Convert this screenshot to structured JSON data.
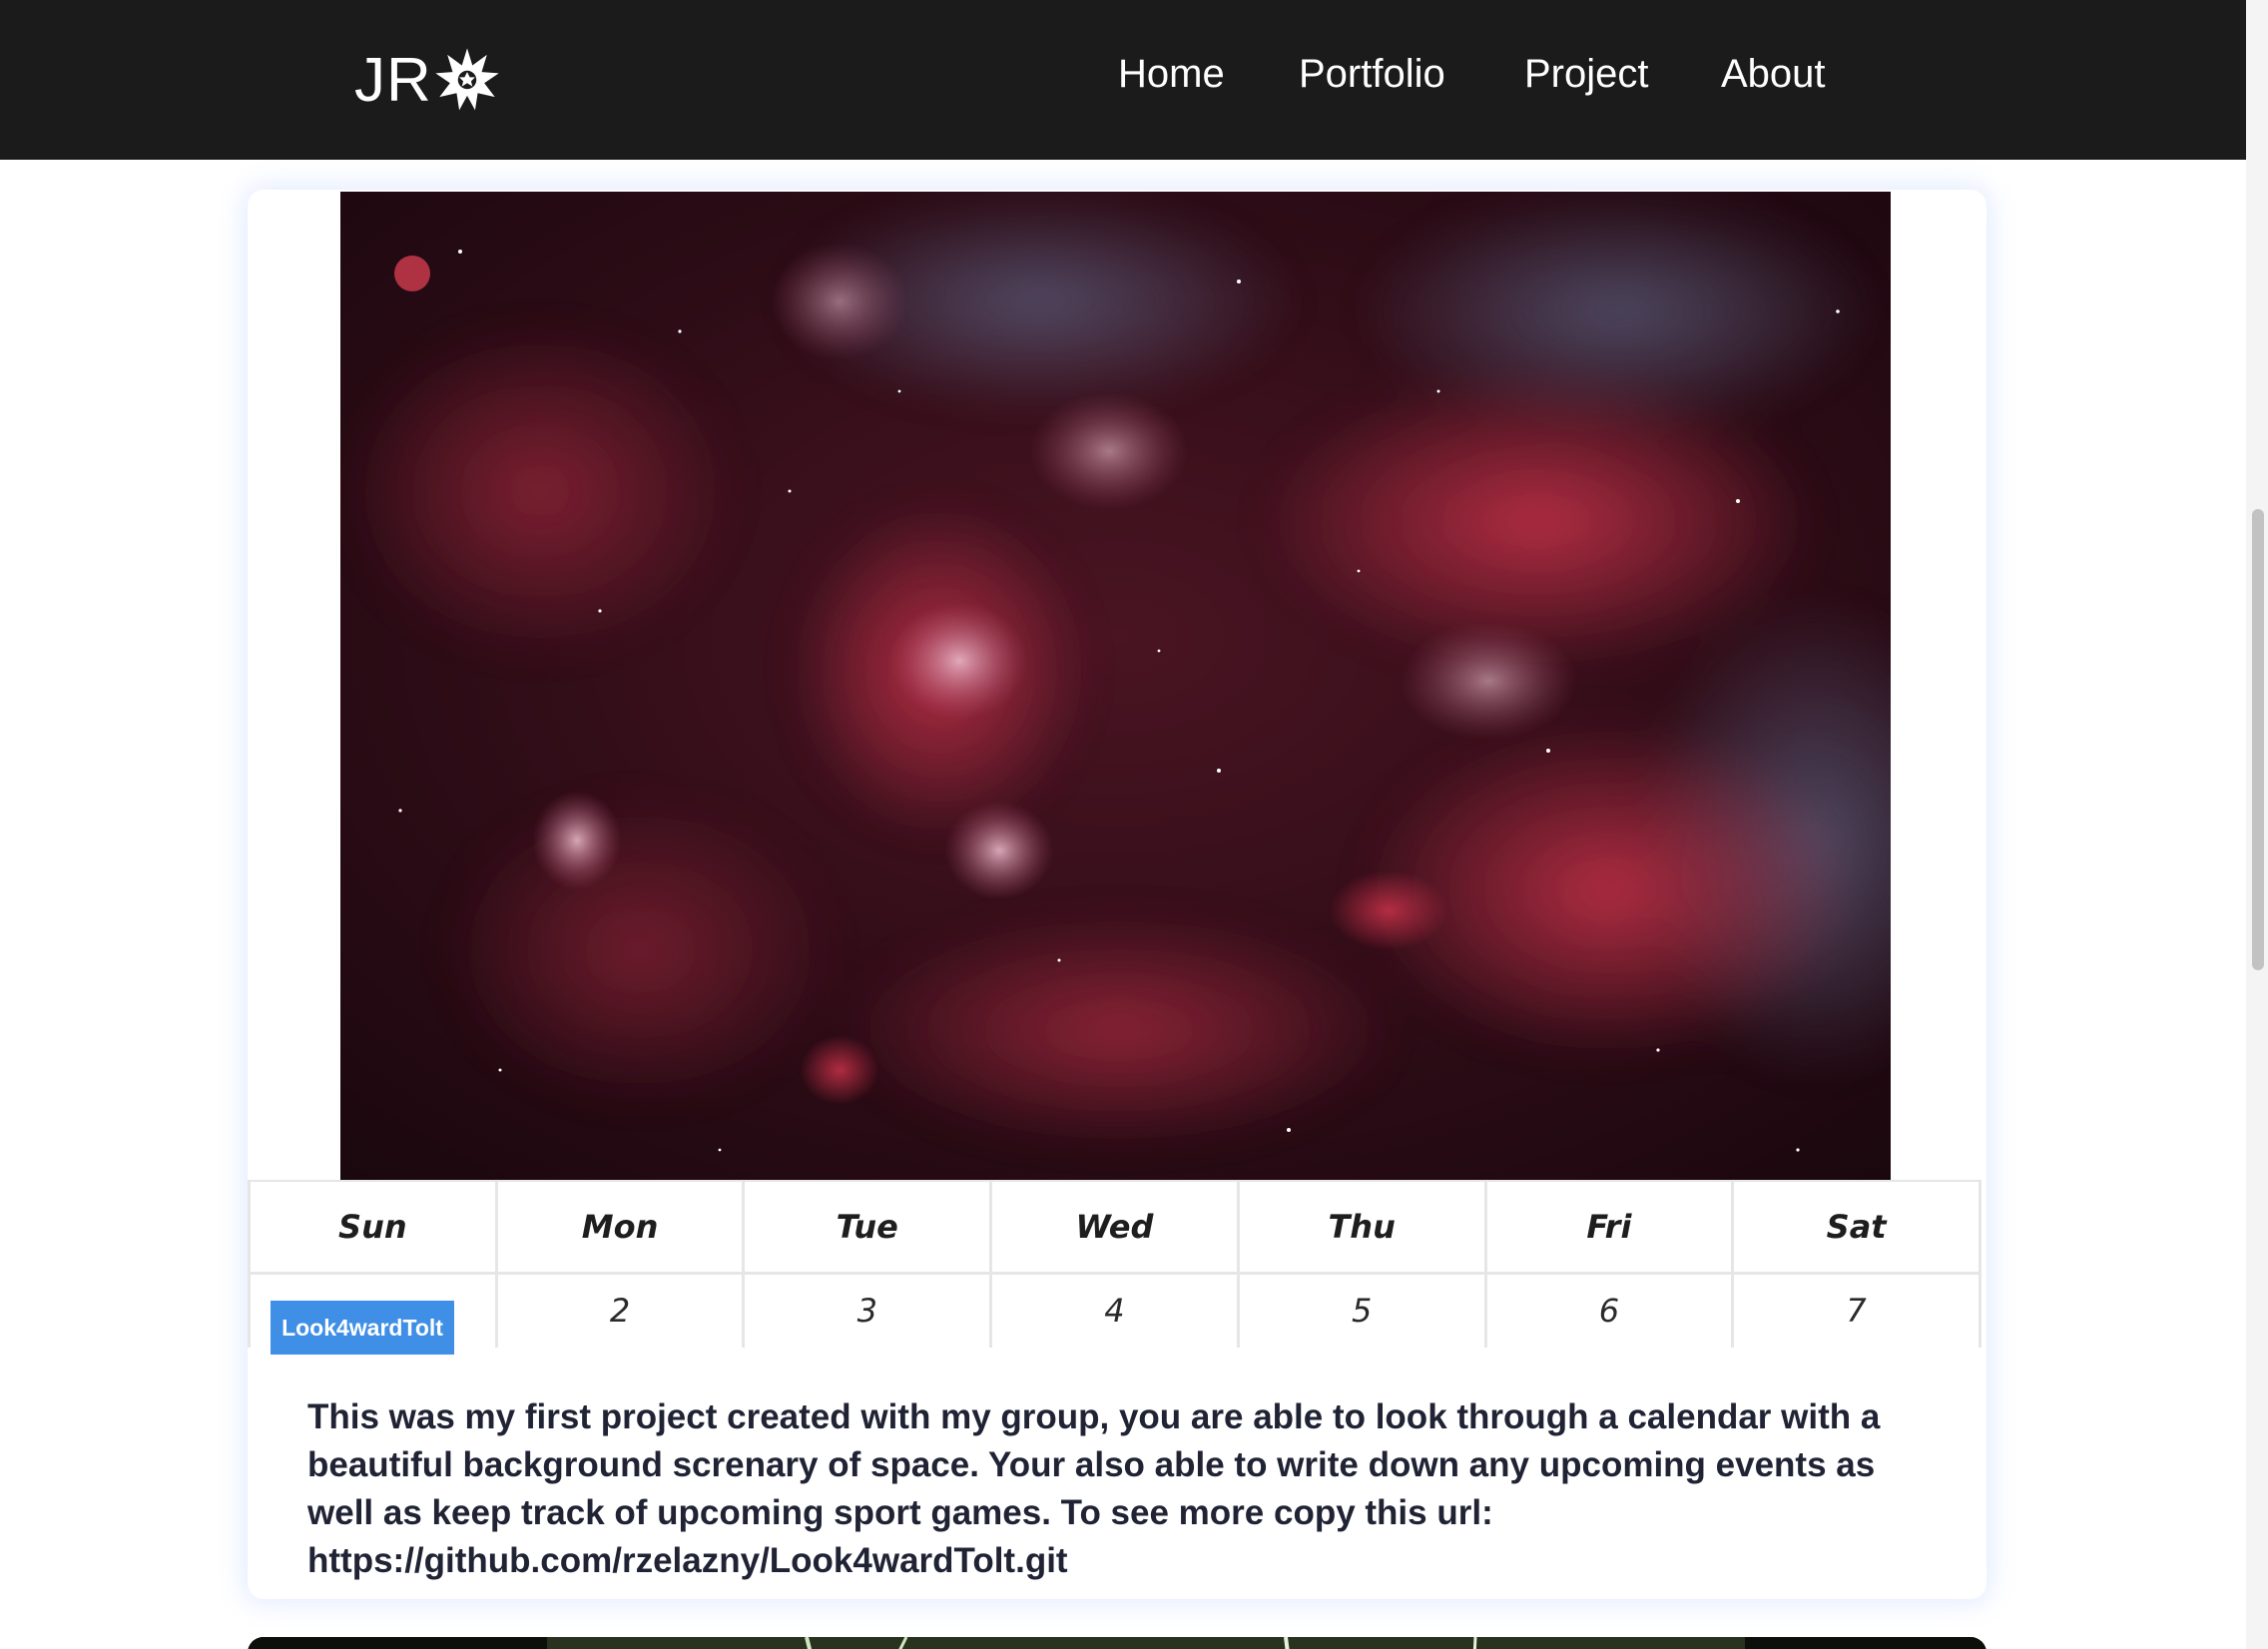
{
  "header": {
    "logo_text": "JR",
    "nav": [
      "Home",
      "Portfolio",
      "Project",
      "About"
    ]
  },
  "project": {
    "image_alt": "space-nebula",
    "calendar": {
      "days": [
        "Sun",
        "Mon",
        "Tue",
        "Wed",
        "Thu",
        "Fri",
        "Sat"
      ],
      "dates": [
        "",
        "2",
        "3",
        "4",
        "5",
        "6",
        "7"
      ],
      "event_label": "Look4wardTolt"
    },
    "description": "This was my first project created with my group, you are able to look through a calendar with a beautiful background screnary of space. Your also able to write down any upcoming events as well as keep track of upcoming sport games. To see more copy this url: https://github.com/rzelazny/Look4wardTolt.git"
  },
  "colors": {
    "navbar": "#1b1b1b",
    "event_tag": "#3f8fe6",
    "text": "#1f2334"
  }
}
